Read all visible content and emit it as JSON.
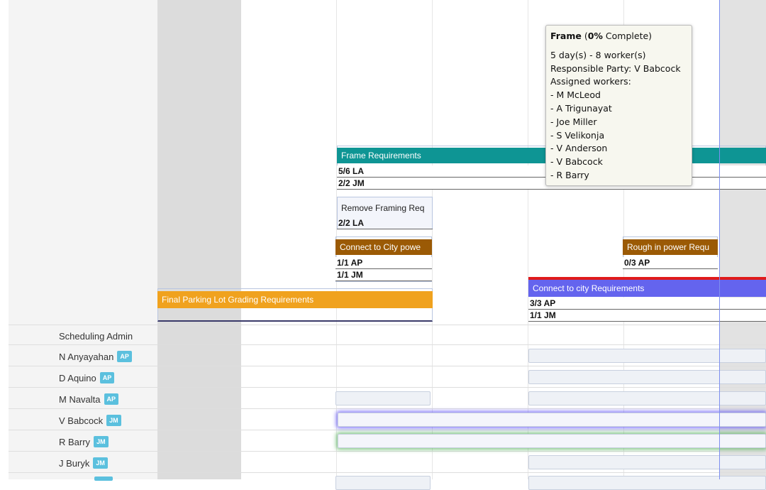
{
  "tasks": {
    "frame_requirements": {
      "label": "Frame Requirements",
      "line1": "5/6 LA",
      "line2": "2/2 JM",
      "color": "#0e9594"
    },
    "remove_framing": {
      "label": "Remove Framing Req",
      "line1": "2/2 LA",
      "color": "#f3f5fb"
    },
    "connect_city_power": {
      "label": "Connect to City powe",
      "line1": "1/1 AP",
      "line2": "1/1 JM",
      "color": "#9b5a05"
    },
    "rough_in_power": {
      "label": "Rough in power Requ",
      "line1": "0/3 AP",
      "color": "#9b5a05"
    },
    "connect_city_req": {
      "label": "Connect to city Requirements",
      "line1": "3/3 AP",
      "line2": "1/1 JM",
      "color": "#6464ee",
      "alert_color": "#e01b1b"
    },
    "final_parking": {
      "label": "Final Parking Lot Grading Requirements",
      "color": "#f0a21e"
    }
  },
  "tooltip": {
    "title": "Frame",
    "percent": "0%",
    "complete_word": "Complete",
    "duration": "5 day(s) - 8 worker(s)",
    "responsible": "Responsible Party: V Babcock",
    "assigned_label": "Assigned workers:",
    "workers": [
      "- M McLeod",
      "- A Trigunayat",
      "- Joe Miller",
      "- S Velikonja",
      "- V Anderson",
      "- V Babcock",
      "- R Barry"
    ]
  },
  "workers": [
    {
      "name": "Scheduling Admin",
      "badge": ""
    },
    {
      "name": "N Anyayahan",
      "badge": "AP"
    },
    {
      "name": "D Aquino",
      "badge": "AP"
    },
    {
      "name": "M Navalta",
      "badge": "AP"
    },
    {
      "name": "V Babcock",
      "badge": "JM"
    },
    {
      "name": "R Barry",
      "badge": "JM"
    },
    {
      "name": "J Buryk",
      "badge": "JM"
    },
    {
      "name": "",
      "badge": ""
    }
  ],
  "colors": {
    "today_line": "#7d8ff0",
    "badge_bg": "#5bc0de",
    "highlight_purple": "#5b4cf5",
    "highlight_green": "#4caf50"
  }
}
